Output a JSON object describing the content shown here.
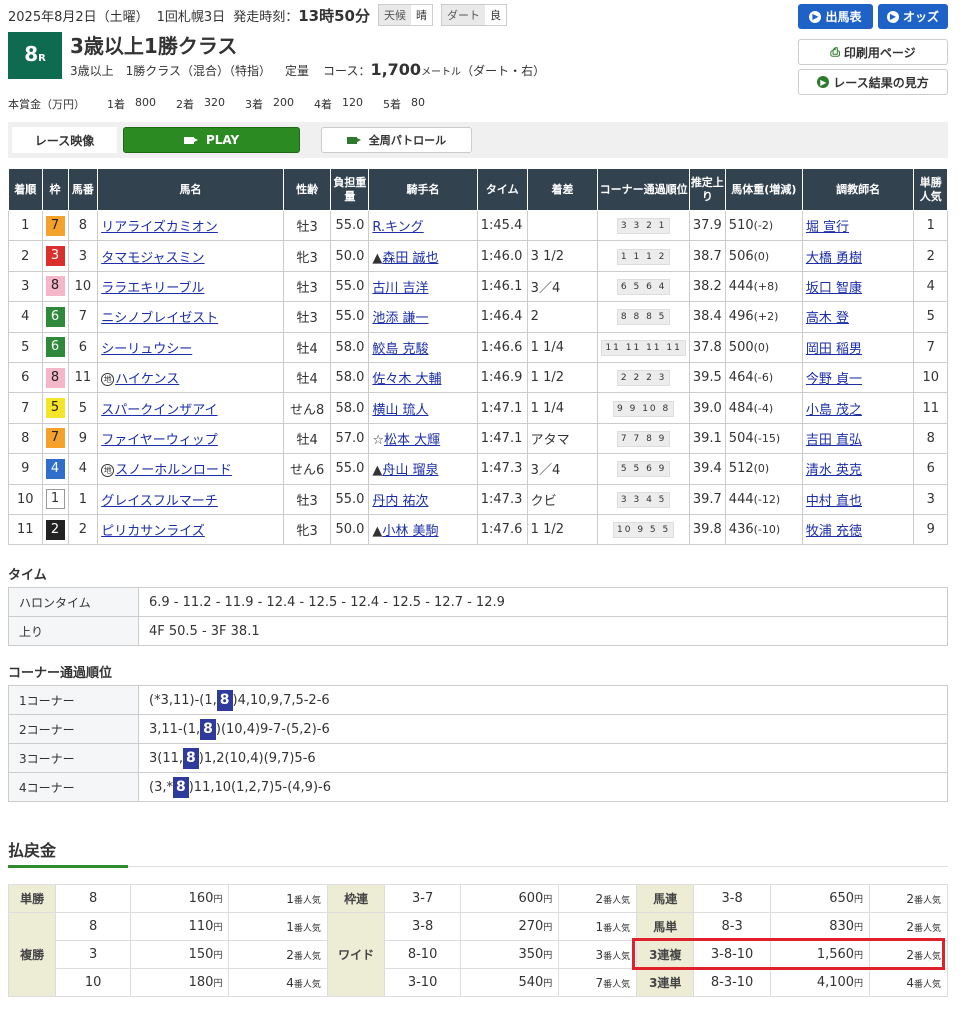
{
  "header": {
    "date": "2025年8月2日（土曜）",
    "meeting": "1回札幌3日",
    "post_label": "発走時刻：",
    "post_time": "13時50分",
    "weather_label": "天候",
    "weather": "晴",
    "track_label": "ダート",
    "track_cond": "良"
  },
  "buttons": {
    "entries": "出馬表",
    "odds": "オッズ",
    "print": "印刷用ページ",
    "howto": "レース結果の見方"
  },
  "race": {
    "num": "8",
    "r": "R",
    "name": "3歳以上1勝クラス",
    "cond1": "3歳以上　1勝クラス（混合）（特指）",
    "cond2": "定量",
    "course_label": "コース：",
    "distance": "1,700",
    "meter": "メートル",
    "surface": "（ダート・右）"
  },
  "prize": {
    "label": "本賞金（万円）",
    "items": [
      {
        "p": "1着",
        "v": "800"
      },
      {
        "p": "2着",
        "v": "320"
      },
      {
        "p": "3着",
        "v": "200"
      },
      {
        "p": "4着",
        "v": "120"
      },
      {
        "p": "5着",
        "v": "80"
      }
    ]
  },
  "video": {
    "label": "レース映像",
    "play": "PLAY",
    "patrol": "全周パトロール"
  },
  "table": {
    "headers": [
      "着順",
      "枠",
      "馬番",
      "馬名",
      "性齢",
      "負担重量",
      "騎手名",
      "タイム",
      "着差",
      "コーナー通過順位",
      "推定上り",
      "馬体重(増減)",
      "調教師名",
      "単勝人気"
    ],
    "rows": [
      {
        "pos": "1",
        "waku": "7",
        "num": "8",
        "chi": "",
        "horse": "リアライズカミオン",
        "sex": "牡3",
        "wt": "55.0",
        "mark": "",
        "jockey": "R.キング",
        "time": "1:45.4",
        "margin": "",
        "corner": "3 3 2 1",
        "last": "37.9",
        "bw": "510",
        "bwd": "(-2)",
        "trainer": "堀 宣行",
        "pop": "1"
      },
      {
        "pos": "2",
        "waku": "3",
        "num": "3",
        "chi": "",
        "horse": "タマモジャスミン",
        "sex": "牝3",
        "wt": "50.0",
        "mark": "▲",
        "jockey": "森田 誠也",
        "time": "1:46.0",
        "margin": "3 1/2",
        "corner": "1 1 1 2",
        "last": "38.7",
        "bw": "506",
        "bwd": "(0)",
        "trainer": "大橋 勇樹",
        "pop": "2"
      },
      {
        "pos": "3",
        "waku": "8",
        "num": "10",
        "chi": "",
        "horse": "ララエキリーブル",
        "sex": "牡3",
        "wt": "55.0",
        "mark": "",
        "jockey": "古川 吉洋",
        "time": "1:46.1",
        "margin": "3／4",
        "corner": "6 5 6 4",
        "last": "38.2",
        "bw": "444",
        "bwd": "(+8)",
        "trainer": "坂口 智康",
        "pop": "4"
      },
      {
        "pos": "4",
        "waku": "6",
        "num": "7",
        "chi": "",
        "horse": "ニシノブレイゼスト",
        "sex": "牡3",
        "wt": "55.0",
        "mark": "",
        "jockey": "池添 謙一",
        "time": "1:46.4",
        "margin": "2",
        "corner": "8 8 8 5",
        "last": "38.4",
        "bw": "496",
        "bwd": "(+2)",
        "trainer": "高木 登",
        "pop": "5"
      },
      {
        "pos": "5",
        "waku": "6",
        "num": "6",
        "chi": "",
        "horse": "シーリュウシー",
        "sex": "牡4",
        "wt": "58.0",
        "mark": "",
        "jockey": "鮫島 克駿",
        "time": "1:46.6",
        "margin": "1 1/4",
        "corner": "11 11 11 11",
        "last": "37.8",
        "bw": "500",
        "bwd": "(0)",
        "trainer": "岡田 稲男",
        "pop": "7"
      },
      {
        "pos": "6",
        "waku": "8",
        "num": "11",
        "chi": "地",
        "horse": "ハイケンス",
        "sex": "牡4",
        "wt": "58.0",
        "mark": "",
        "jockey": "佐々木 大輔",
        "time": "1:46.9",
        "margin": "1 1/2",
        "corner": "2 2 2 3",
        "last": "39.5",
        "bw": "464",
        "bwd": "(-6)",
        "trainer": "今野 貞一",
        "pop": "10"
      },
      {
        "pos": "7",
        "waku": "5",
        "num": "5",
        "chi": "",
        "horse": "スパークインザアイ",
        "sex": "せん8",
        "wt": "58.0",
        "mark": "",
        "jockey": "横山 琉人",
        "time": "1:47.1",
        "margin": "1 1/4",
        "corner": "9 9 10 8",
        "last": "39.0",
        "bw": "484",
        "bwd": "(-4)",
        "trainer": "小島 茂之",
        "pop": "11"
      },
      {
        "pos": "8",
        "waku": "7",
        "num": "9",
        "chi": "",
        "horse": "ファイヤーウィップ",
        "sex": "牡4",
        "wt": "57.0",
        "mark": "☆",
        "jockey": "松本 大輝",
        "time": "1:47.1",
        "margin": "アタマ",
        "corner": "7 7 8 9",
        "last": "39.1",
        "bw": "504",
        "bwd": "(-15)",
        "trainer": "吉田 直弘",
        "pop": "8"
      },
      {
        "pos": "9",
        "waku": "4",
        "num": "4",
        "chi": "地",
        "horse": "スノーホルンロード",
        "sex": "せん6",
        "wt": "55.0",
        "mark": "▲",
        "jockey": "舟山 瑠泉",
        "time": "1:47.3",
        "margin": "3／4",
        "corner": "5 5 6 9",
        "last": "39.4",
        "bw": "512",
        "bwd": "(0)",
        "trainer": "清水 英克",
        "pop": "6"
      },
      {
        "pos": "10",
        "waku": "1",
        "num": "1",
        "chi": "",
        "horse": "グレイスフルマーチ",
        "sex": "牡3",
        "wt": "55.0",
        "mark": "",
        "jockey": "丹内 祐次",
        "time": "1:47.3",
        "margin": "クビ",
        "corner": "3 3 4 5",
        "last": "39.7",
        "bw": "444",
        "bwd": "(-12)",
        "trainer": "中村 直也",
        "pop": "3"
      },
      {
        "pos": "11",
        "waku": "2",
        "num": "2",
        "chi": "",
        "horse": "ピリカサンライズ",
        "sex": "牝3",
        "wt": "50.0",
        "mark": "▲",
        "jockey": "小林 美駒",
        "time": "1:47.6",
        "margin": "1 1/2",
        "corner": "10 9 5 5",
        "last": "39.8",
        "bw": "436",
        "bwd": "(-10)",
        "trainer": "牧浦 充徳",
        "pop": "9"
      }
    ]
  },
  "timesec": {
    "title": "タイム",
    "furlong_label": "ハロンタイム",
    "furlong": "6.9 - 11.2 - 11.9 - 12.4 - 12.5 - 12.4 - 12.5 - 12.7 - 12.9",
    "agari_label": "上り",
    "agari": "4F 50.5 - 3F 38.1"
  },
  "cornersec": {
    "title": "コーナー通過順位",
    "rows": [
      {
        "label": "1コーナー",
        "pre": "(*3,11)-(1,",
        "hl": "8",
        "post": ")4,10,9,7,5-2-6"
      },
      {
        "label": "2コーナー",
        "pre": "3,11-(1,",
        "hl": "8",
        "post": ")(10,4)9-7-(5,2)-6"
      },
      {
        "label": "3コーナー",
        "pre": "3(11,",
        "hl": "8",
        "post": ")1,2(10,4)(9,7)5-6"
      },
      {
        "label": "4コーナー",
        "pre": "(3,*",
        "hl": "8",
        "post": ")11,10(1,2,7)5-(4,9)-6"
      }
    ]
  },
  "payout": {
    "title": "払戻金",
    "yen": "円",
    "popsuffix": "番人気",
    "tansho": {
      "label": "単勝",
      "num": "8",
      "amt": "160",
      "pop": "1"
    },
    "fukusho": {
      "label": "複勝",
      "items": [
        {
          "num": "8",
          "amt": "110",
          "pop": "1"
        },
        {
          "num": "3",
          "amt": "150",
          "pop": "2"
        },
        {
          "num": "10",
          "amt": "180",
          "pop": "4"
        }
      ]
    },
    "wakuren": {
      "label": "枠連",
      "num": "3-7",
      "amt": "600",
      "pop": "2"
    },
    "wide": {
      "label": "ワイド",
      "items": [
        {
          "num": "3-8",
          "amt": "270",
          "pop": "1"
        },
        {
          "num": "8-10",
          "amt": "350",
          "pop": "3"
        },
        {
          "num": "3-10",
          "amt": "540",
          "pop": "7"
        }
      ]
    },
    "umaren": {
      "label": "馬連",
      "num": "3-8",
      "amt": "650",
      "pop": "2"
    },
    "umatan": {
      "label": "馬単",
      "num": "8-3",
      "amt": "830",
      "pop": "2"
    },
    "sanrenpuku": {
      "label": "3連複",
      "num": "3-8-10",
      "amt": "1,560",
      "pop": "2"
    },
    "sanrentan": {
      "label": "3連単",
      "num": "8-3-10",
      "amt": "4,100",
      "pop": "4"
    }
  },
  "colors": {
    "header_bg": "#32424f",
    "highlight_box": "#e0202a",
    "accent_blue": "#1f62c7",
    "play_green": "#2c8a23"
  }
}
